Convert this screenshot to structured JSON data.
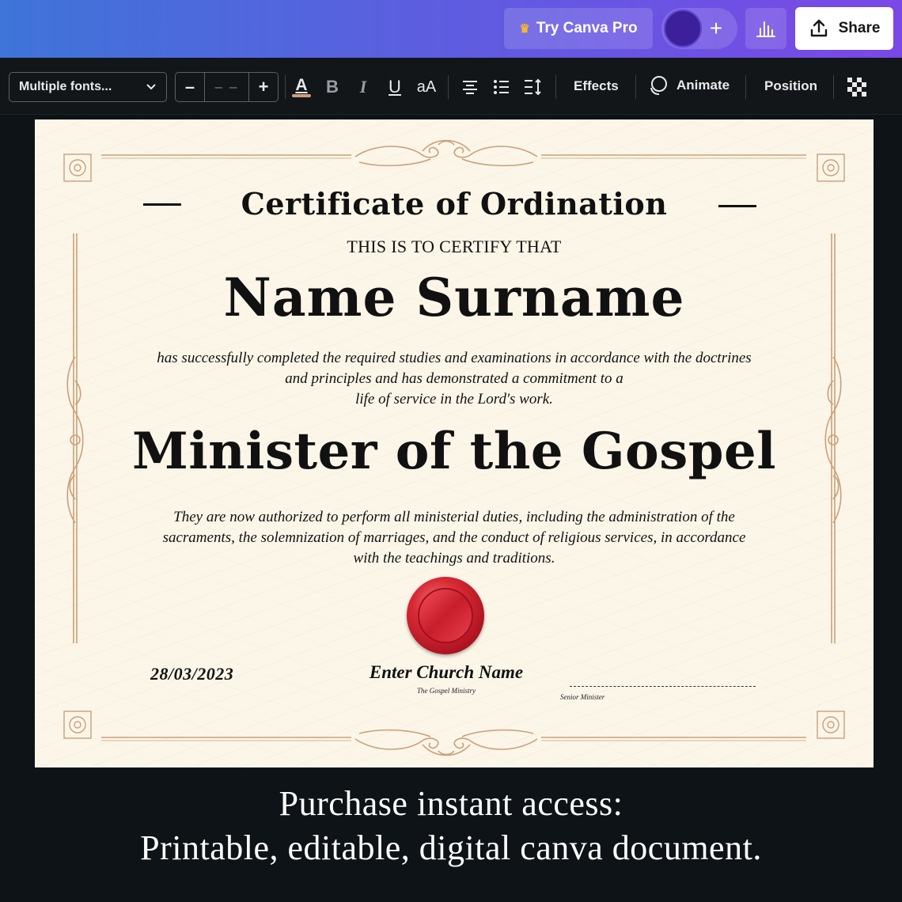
{
  "topbar": {
    "try_pro_label": "Try Canva Pro",
    "share_label": "Share",
    "add_symbol": "+",
    "colors": {
      "gradient_start": "#3f74d9",
      "gradient_end": "#7a48e6",
      "avatar": "#3c1f9a"
    }
  },
  "toolbar": {
    "font_select_value": "Multiple fonts...",
    "font_size_decrease": "–",
    "font_size_value": "– –",
    "font_size_increase": "+",
    "text_color_glyph": "A",
    "bold_glyph": "B",
    "italic_glyph": "I",
    "underline_glyph": "U",
    "case_glyph": "aA",
    "effects_label": "Effects",
    "animate_label": "Animate",
    "position_label": "Position",
    "icons": [
      "chevron-down-icon",
      "text-color-icon",
      "bold-icon",
      "italic-icon",
      "underline-icon",
      "letter-case-icon",
      "align-center-icon",
      "bulleted-list-icon",
      "line-spacing-icon",
      "animate-icon",
      "transparency-icon"
    ]
  },
  "certificate": {
    "title": "Certificate of Ordination",
    "certify_line": "THIS IS TO CERTIFY THAT",
    "recipient_name": "Name Surname",
    "paragraph1": [
      "has successfully completed the required studies and examinations in accordance with the doctrines",
      "and principles and has demonstrated a commitment to a",
      "life of service in the Lord's work."
    ],
    "role": "Minister of the Gospel",
    "paragraph2": [
      "They are now authorized to perform all ministerial duties, including the administration of the",
      "sacraments, the solemnization of marriages, and the conduct of religious services, in accordance",
      "with the teachings and traditions."
    ],
    "date": "28/03/2023",
    "church_name": "Enter Church Name",
    "church_subtitle": "The Gospel Ministry",
    "signature_label": "Senior Minister",
    "colors": {
      "paper": "#fbf6e8",
      "ornament": "#c9a07a",
      "seal": "#d92a36"
    }
  },
  "promo": {
    "line1": "Purchase instant access:",
    "line2": "Printable, editable, digital canva document."
  }
}
